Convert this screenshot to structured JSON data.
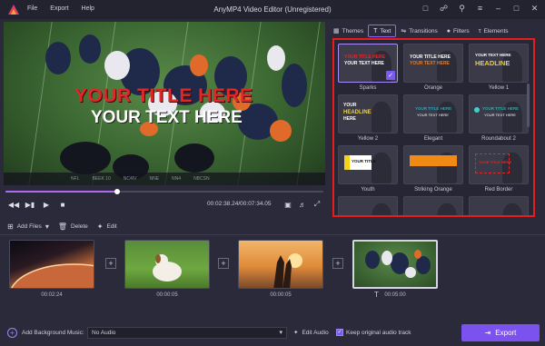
{
  "app": {
    "title": "AnyMP4 Video Editor (Unregistered)",
    "menu": [
      "File",
      "Export",
      "Help"
    ]
  },
  "player": {
    "overlay_title": "YOUR TITLE HERE",
    "overlay_text": "YOUR TEXT HERE",
    "banner_items": [
      "NFL",
      "BEEK 10",
      "NC4IV",
      "NNE",
      "NN4",
      "NBCSN"
    ],
    "time_current": "00:02:38.24",
    "time_total": "00:07:34.05",
    "progress_percent": 35
  },
  "tabs": [
    {
      "label": "Themes",
      "icon": "themes-icon"
    },
    {
      "label": "Text",
      "icon": "text-icon",
      "active": true
    },
    {
      "label": "Transitions",
      "icon": "transitions-icon"
    },
    {
      "label": "Filters",
      "icon": "filters-icon"
    },
    {
      "label": "Elements",
      "icon": "elements-icon"
    }
  ],
  "text_templates": [
    {
      "name": "Sparks",
      "lines": [
        "YOUR TITLE HERE",
        "YOUR TEXT HERE"
      ],
      "selected": true
    },
    {
      "name": "Orange",
      "lines": [
        "YOUR TITLE HERE",
        "YOUR TEXT HERE"
      ]
    },
    {
      "name": "Yellow 1",
      "lines": [
        "YOUR TEXT HERE",
        "HEADLINE"
      ]
    },
    {
      "name": "Yellow 2",
      "lines": [
        "YOUR",
        "HEADLINE",
        "HERE"
      ]
    },
    {
      "name": "Elegant",
      "lines": [
        "YOUR TITLE HERE",
        "YOUR TEXT HERE"
      ]
    },
    {
      "name": "Roundabout 2",
      "lines": [
        "YOUR TITLE HERE",
        "YOUR TEXT HERE"
      ]
    },
    {
      "name": "Youth",
      "lines": [
        "YOUR TITLE"
      ]
    },
    {
      "name": "Striking Orange",
      "lines": []
    },
    {
      "name": "Red Border",
      "lines": [
        "YOUR TITLE HERE"
      ]
    }
  ],
  "toolbar": {
    "add_files": "Add Files",
    "delete": "Delete",
    "edit": "Edit"
  },
  "clips": [
    {
      "duration": "00:02:24"
    },
    {
      "duration": "00:00:05"
    },
    {
      "duration": "00:00:05"
    },
    {
      "duration": "00:05:00",
      "selected": true
    }
  ],
  "bottom": {
    "add_bg_music": "Add Background Music:",
    "audio_value": "No Audio",
    "edit_audio": "Edit Audio",
    "keep_original": "Keep original audio track",
    "keep_checked": true,
    "export": "Export"
  },
  "colors": {
    "accent": "#7b52ee",
    "highlight_border": "#e81c1c",
    "overlay_title": "#e02828"
  }
}
